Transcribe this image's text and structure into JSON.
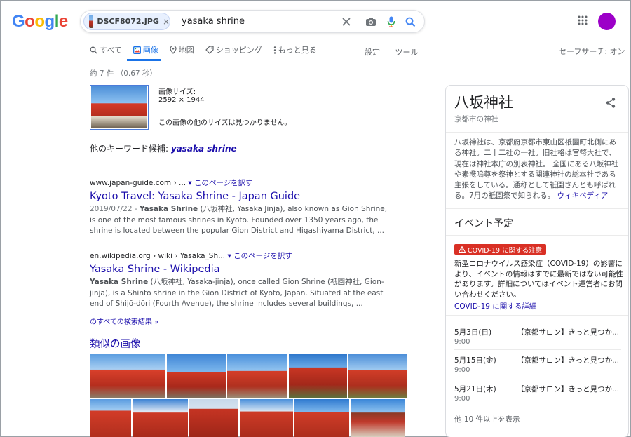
{
  "colors": {
    "accent": "#1a73e8",
    "link": "#1a0dab",
    "avatar": "#9c00c8",
    "alert": "#d93025"
  },
  "logo": {
    "letters": [
      "G",
      "o",
      "o",
      "g",
      "l",
      "e"
    ],
    "colors": [
      "#4285f4",
      "#ea4335",
      "#fbbc05",
      "#4285f4",
      "#34a853",
      "#ea4335"
    ]
  },
  "search": {
    "chip_label": "DSCF8072.JPG",
    "chip_close": "×",
    "query": "yasaka shrine"
  },
  "tabs": [
    {
      "label": "すべて",
      "icon": "search-icon"
    },
    {
      "label": "画像",
      "icon": "image-icon",
      "active": true
    },
    {
      "label": "地図",
      "icon": "map-pin-icon"
    },
    {
      "label": "ショッピング",
      "icon": "tag-icon"
    },
    {
      "label": "もっと見る",
      "icon": "more-vert-icon"
    }
  ],
  "tools": {
    "settings": "設定",
    "tools": "ツール",
    "safesearch": "セーフサーチ: オン"
  },
  "stats": "約 7 件 （0.67 秒）",
  "image_info": {
    "size_label": "画像サイズ:",
    "size_value": "2592 × 1944",
    "no_other_sizes": "この画像の他のサイズは見つかりません。",
    "keyword_prefix": "他のキーワード候補: ",
    "keyword": "yasaka shrine"
  },
  "results": [
    {
      "url": "www.japan-guide.com › ...",
      "translate": "このページを訳す",
      "title": "Kyoto Travel: Yasaka Shrine - Japan Guide",
      "date": "2019/07/22 - ",
      "bold": "Yasaka Shrine",
      "snippet": " (八坂神社, Yasaka Jinja), also known as Gion Shrine, is one of the most famous shrines in Kyoto. Founded over 1350 years ago, the shrine is located between the popular Gion District and Higashiyama District, ..."
    },
    {
      "url": "en.wikipedia.org › wiki › Yasaka_Sh...",
      "translate": "このページを訳す",
      "title": "Yasaka Shrine - Wikipedia",
      "date": "",
      "bold": "Yasaka Shrine",
      "snippet": " (八坂神社, Yasaka-jinja), once called Gion Shrine (祇園神社, Gion-jinja), is a Shinto shrine in the Gion District of Kyoto, Japan. Situated at the east end of Shijō-dōri (Fourth Avenue), the shrine includes several buildings, ..."
    }
  ],
  "all_results": "のすべての検索結果 »",
  "similar_images_title": "類似の画像",
  "knowledge_panel": {
    "title": "八坂神社",
    "subtitle": "京都市の神社",
    "description": "八坂神社は、京都府京都市東山区祇園町北側にある神社。二十二社の一社。旧社格は官幣大社で、現在は神社本庁の別表神社。 全国にある八坂神社や素戔嗚尊を祭神とする関連神社の総本社である主張をしている。通称として祇園さんとも呼ばれる。7月の祇園祭で知られる。",
    "wiki_link": "ウィキペディア",
    "events_title": "イベント予定",
    "covid_badge": "COVID-19 に関する注意",
    "covid_text": "新型コロナウイルス感染症（COVID-19）の影響により、イベントの情報はすでに最新ではない可能性があります。詳細についてはイベント運営者にお問い合わせください。",
    "covid_link": "COVID-19 に関する詳細",
    "events": [
      {
        "date": "5月3日(日)",
        "time": "9:00",
        "name": "【京都サロン】きっと見つか..."
      },
      {
        "date": "5月15日(金)",
        "time": "9:00",
        "name": "【京都サロン】きっと見つか..."
      },
      {
        "date": "5月21日(木)",
        "time": "9:00",
        "name": "【京都サロン】きっと見つか..."
      }
    ],
    "more_events": "他 10 件以上を表示"
  }
}
